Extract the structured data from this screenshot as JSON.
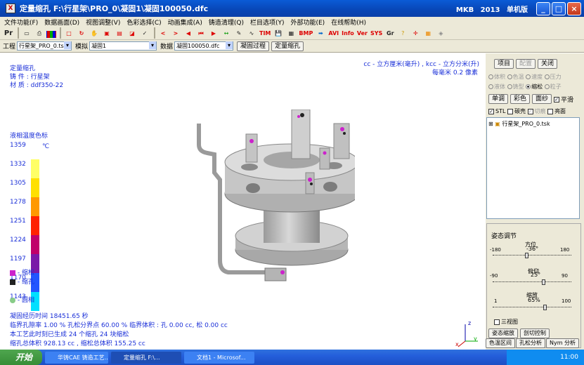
{
  "window": {
    "title": "定量缩孔  F:\\行星架\\PRO_0\\凝固1\\凝固100050.dfc",
    "right_info": "MKB  2013  单机版",
    "minimize": "_",
    "maximize": "□",
    "close": "×"
  },
  "menu": [
    "文件功能(F)",
    "数据画面(D)",
    "视图调整(V)",
    "色彩选择(C)",
    "动画集成(A)",
    "铸造清理(Q)",
    "栏目选项(Y)",
    "外部功能(E)",
    "在线帮助(H)"
  ],
  "toolbar": {
    "items": [
      "Pr",
      "TIM",
      "BMP",
      "AVI",
      "Info",
      "Ver",
      "SYS",
      "Gr"
    ]
  },
  "selectors": {
    "project_label": "工程",
    "project_value": "行星架_PRO_0.tsk",
    "module_label": "模拟",
    "module_value": "凝固1",
    "data_label": "数据",
    "data_value": "凝固100050.dfc",
    "btn_process": "凝固过程",
    "btn_shrink": "定量缩孔"
  },
  "viewport": {
    "heading": "定量缩孔",
    "part_label": "铸    件",
    "part_value": "行星架",
    "material_label": "材    质",
    "material_value": "ddf350-22",
    "units_line": "cc - 立方厘米(毫升) , kcc - 立方分米(升)",
    "pixel_scale": "每毫米 0.2 像素",
    "legend_title": "液相温度色标",
    "legend_unit": "℃",
    "legend_values": [
      "1359",
      "1332",
      "1305",
      "1278",
      "1251",
      "1224",
      "1197",
      "1170",
      "1143"
    ],
    "legend_colors": [
      "#ffffff",
      "#ffff66",
      "#ffe000",
      "#ff9900",
      "#ff2200",
      "#c0006a",
      "#7a1aa8",
      "#2255ff",
      "#00e0ff"
    ],
    "legend_items": [
      {
        "label": "- 缩松",
        "color": "#cc22cc"
      },
      {
        "label": "- 缩孔",
        "color": "#222222"
      },
      {
        "label": "- 圆相",
        "color": "#88cc88"
      }
    ],
    "info_lines": [
      "凝固经历时间 18451.65 秒",
      "临界孔隙率 1.00 %      孔松分界点 60.00 %      临界体积 :  孔 0.00 cc, 松 0.00 cc",
      "本工艺此时刻已生成 24 个缩孔 24 块缩松",
      "缩孔总体积 928.13 cc , 缩松总体积 155.25 cc"
    ],
    "axis_z": "z",
    "axis_y": "y",
    "axis_x": "x"
  },
  "panel": {
    "btn_project": "项目",
    "btn_config": "配置",
    "btn_close": "关闭",
    "radio_row1": [
      "体积",
      "色温",
      "速度",
      "压力"
    ],
    "radio_row2": [
      "液体",
      "铸型",
      "缩松",
      "粒子"
    ],
    "selected_radio": "缩松",
    "btn_mono": "单调",
    "btn_color": "彩色",
    "btn_surface": "面纱",
    "chk_smooth": "平滑",
    "chk_stl": "STL",
    "chk_translucent": "碳壳",
    "chk_cut": "切痕",
    "chk_bright": "亮面",
    "tree_item": "行星架_PRO_0.tsk",
    "pose_title": "姿态调节",
    "azimuth_label": "方位",
    "azimuth_min": "-180",
    "azimuth_value": "-36°",
    "azimuth_max": "180",
    "pitch_label": "俯仰",
    "pitch_min": "-90",
    "pitch_value": "25°",
    "pitch_max": "90",
    "zoom_label": "缩放",
    "zoom_min": "1",
    "zoom_value": "65%",
    "zoom_max": "100",
    "chk_three_view": "三视图",
    "btn_pose_zoom": "姿态缩放",
    "btn_cut_control": "剖切控制",
    "btn_color_range": "色温区间",
    "btn_hole_analysis": "孔松分析",
    "btn_nym": "Nym 分析"
  },
  "taskbar": {
    "start": "开始",
    "tasks": [
      "华铸CAE 铸造工艺...",
      "定量缩孔 F:\\...",
      "文档1 - Microsof..."
    ],
    "clock": "11:00"
  }
}
